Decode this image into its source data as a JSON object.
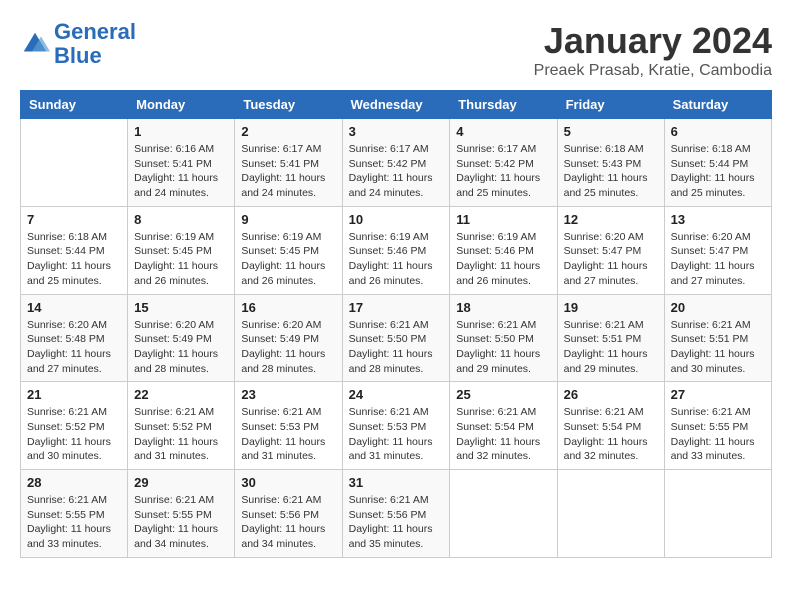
{
  "header": {
    "logo_line1": "General",
    "logo_line2": "Blue",
    "month_title": "January 2024",
    "subtitle": "Preaek Prasab, Kratie, Cambodia"
  },
  "weekdays": [
    "Sunday",
    "Monday",
    "Tuesday",
    "Wednesday",
    "Thursday",
    "Friday",
    "Saturday"
  ],
  "weeks": [
    [
      {
        "day": "",
        "info": ""
      },
      {
        "day": "1",
        "info": "Sunrise: 6:16 AM\nSunset: 5:41 PM\nDaylight: 11 hours\nand 24 minutes."
      },
      {
        "day": "2",
        "info": "Sunrise: 6:17 AM\nSunset: 5:41 PM\nDaylight: 11 hours\nand 24 minutes."
      },
      {
        "day": "3",
        "info": "Sunrise: 6:17 AM\nSunset: 5:42 PM\nDaylight: 11 hours\nand 24 minutes."
      },
      {
        "day": "4",
        "info": "Sunrise: 6:17 AM\nSunset: 5:42 PM\nDaylight: 11 hours\nand 25 minutes."
      },
      {
        "day": "5",
        "info": "Sunrise: 6:18 AM\nSunset: 5:43 PM\nDaylight: 11 hours\nand 25 minutes."
      },
      {
        "day": "6",
        "info": "Sunrise: 6:18 AM\nSunset: 5:44 PM\nDaylight: 11 hours\nand 25 minutes."
      }
    ],
    [
      {
        "day": "7",
        "info": "Sunrise: 6:18 AM\nSunset: 5:44 PM\nDaylight: 11 hours\nand 25 minutes."
      },
      {
        "day": "8",
        "info": "Sunrise: 6:19 AM\nSunset: 5:45 PM\nDaylight: 11 hours\nand 26 minutes."
      },
      {
        "day": "9",
        "info": "Sunrise: 6:19 AM\nSunset: 5:45 PM\nDaylight: 11 hours\nand 26 minutes."
      },
      {
        "day": "10",
        "info": "Sunrise: 6:19 AM\nSunset: 5:46 PM\nDaylight: 11 hours\nand 26 minutes."
      },
      {
        "day": "11",
        "info": "Sunrise: 6:19 AM\nSunset: 5:46 PM\nDaylight: 11 hours\nand 26 minutes."
      },
      {
        "day": "12",
        "info": "Sunrise: 6:20 AM\nSunset: 5:47 PM\nDaylight: 11 hours\nand 27 minutes."
      },
      {
        "day": "13",
        "info": "Sunrise: 6:20 AM\nSunset: 5:47 PM\nDaylight: 11 hours\nand 27 minutes."
      }
    ],
    [
      {
        "day": "14",
        "info": "Sunrise: 6:20 AM\nSunset: 5:48 PM\nDaylight: 11 hours\nand 27 minutes."
      },
      {
        "day": "15",
        "info": "Sunrise: 6:20 AM\nSunset: 5:49 PM\nDaylight: 11 hours\nand 28 minutes."
      },
      {
        "day": "16",
        "info": "Sunrise: 6:20 AM\nSunset: 5:49 PM\nDaylight: 11 hours\nand 28 minutes."
      },
      {
        "day": "17",
        "info": "Sunrise: 6:21 AM\nSunset: 5:50 PM\nDaylight: 11 hours\nand 28 minutes."
      },
      {
        "day": "18",
        "info": "Sunrise: 6:21 AM\nSunset: 5:50 PM\nDaylight: 11 hours\nand 29 minutes."
      },
      {
        "day": "19",
        "info": "Sunrise: 6:21 AM\nSunset: 5:51 PM\nDaylight: 11 hours\nand 29 minutes."
      },
      {
        "day": "20",
        "info": "Sunrise: 6:21 AM\nSunset: 5:51 PM\nDaylight: 11 hours\nand 30 minutes."
      }
    ],
    [
      {
        "day": "21",
        "info": "Sunrise: 6:21 AM\nSunset: 5:52 PM\nDaylight: 11 hours\nand 30 minutes."
      },
      {
        "day": "22",
        "info": "Sunrise: 6:21 AM\nSunset: 5:52 PM\nDaylight: 11 hours\nand 31 minutes."
      },
      {
        "day": "23",
        "info": "Sunrise: 6:21 AM\nSunset: 5:53 PM\nDaylight: 11 hours\nand 31 minutes."
      },
      {
        "day": "24",
        "info": "Sunrise: 6:21 AM\nSunset: 5:53 PM\nDaylight: 11 hours\nand 31 minutes."
      },
      {
        "day": "25",
        "info": "Sunrise: 6:21 AM\nSunset: 5:54 PM\nDaylight: 11 hours\nand 32 minutes."
      },
      {
        "day": "26",
        "info": "Sunrise: 6:21 AM\nSunset: 5:54 PM\nDaylight: 11 hours\nand 32 minutes."
      },
      {
        "day": "27",
        "info": "Sunrise: 6:21 AM\nSunset: 5:55 PM\nDaylight: 11 hours\nand 33 minutes."
      }
    ],
    [
      {
        "day": "28",
        "info": "Sunrise: 6:21 AM\nSunset: 5:55 PM\nDaylight: 11 hours\nand 33 minutes."
      },
      {
        "day": "29",
        "info": "Sunrise: 6:21 AM\nSunset: 5:55 PM\nDaylight: 11 hours\nand 34 minutes."
      },
      {
        "day": "30",
        "info": "Sunrise: 6:21 AM\nSunset: 5:56 PM\nDaylight: 11 hours\nand 34 minutes."
      },
      {
        "day": "31",
        "info": "Sunrise: 6:21 AM\nSunset: 5:56 PM\nDaylight: 11 hours\nand 35 minutes."
      },
      {
        "day": "",
        "info": ""
      },
      {
        "day": "",
        "info": ""
      },
      {
        "day": "",
        "info": ""
      }
    ]
  ]
}
